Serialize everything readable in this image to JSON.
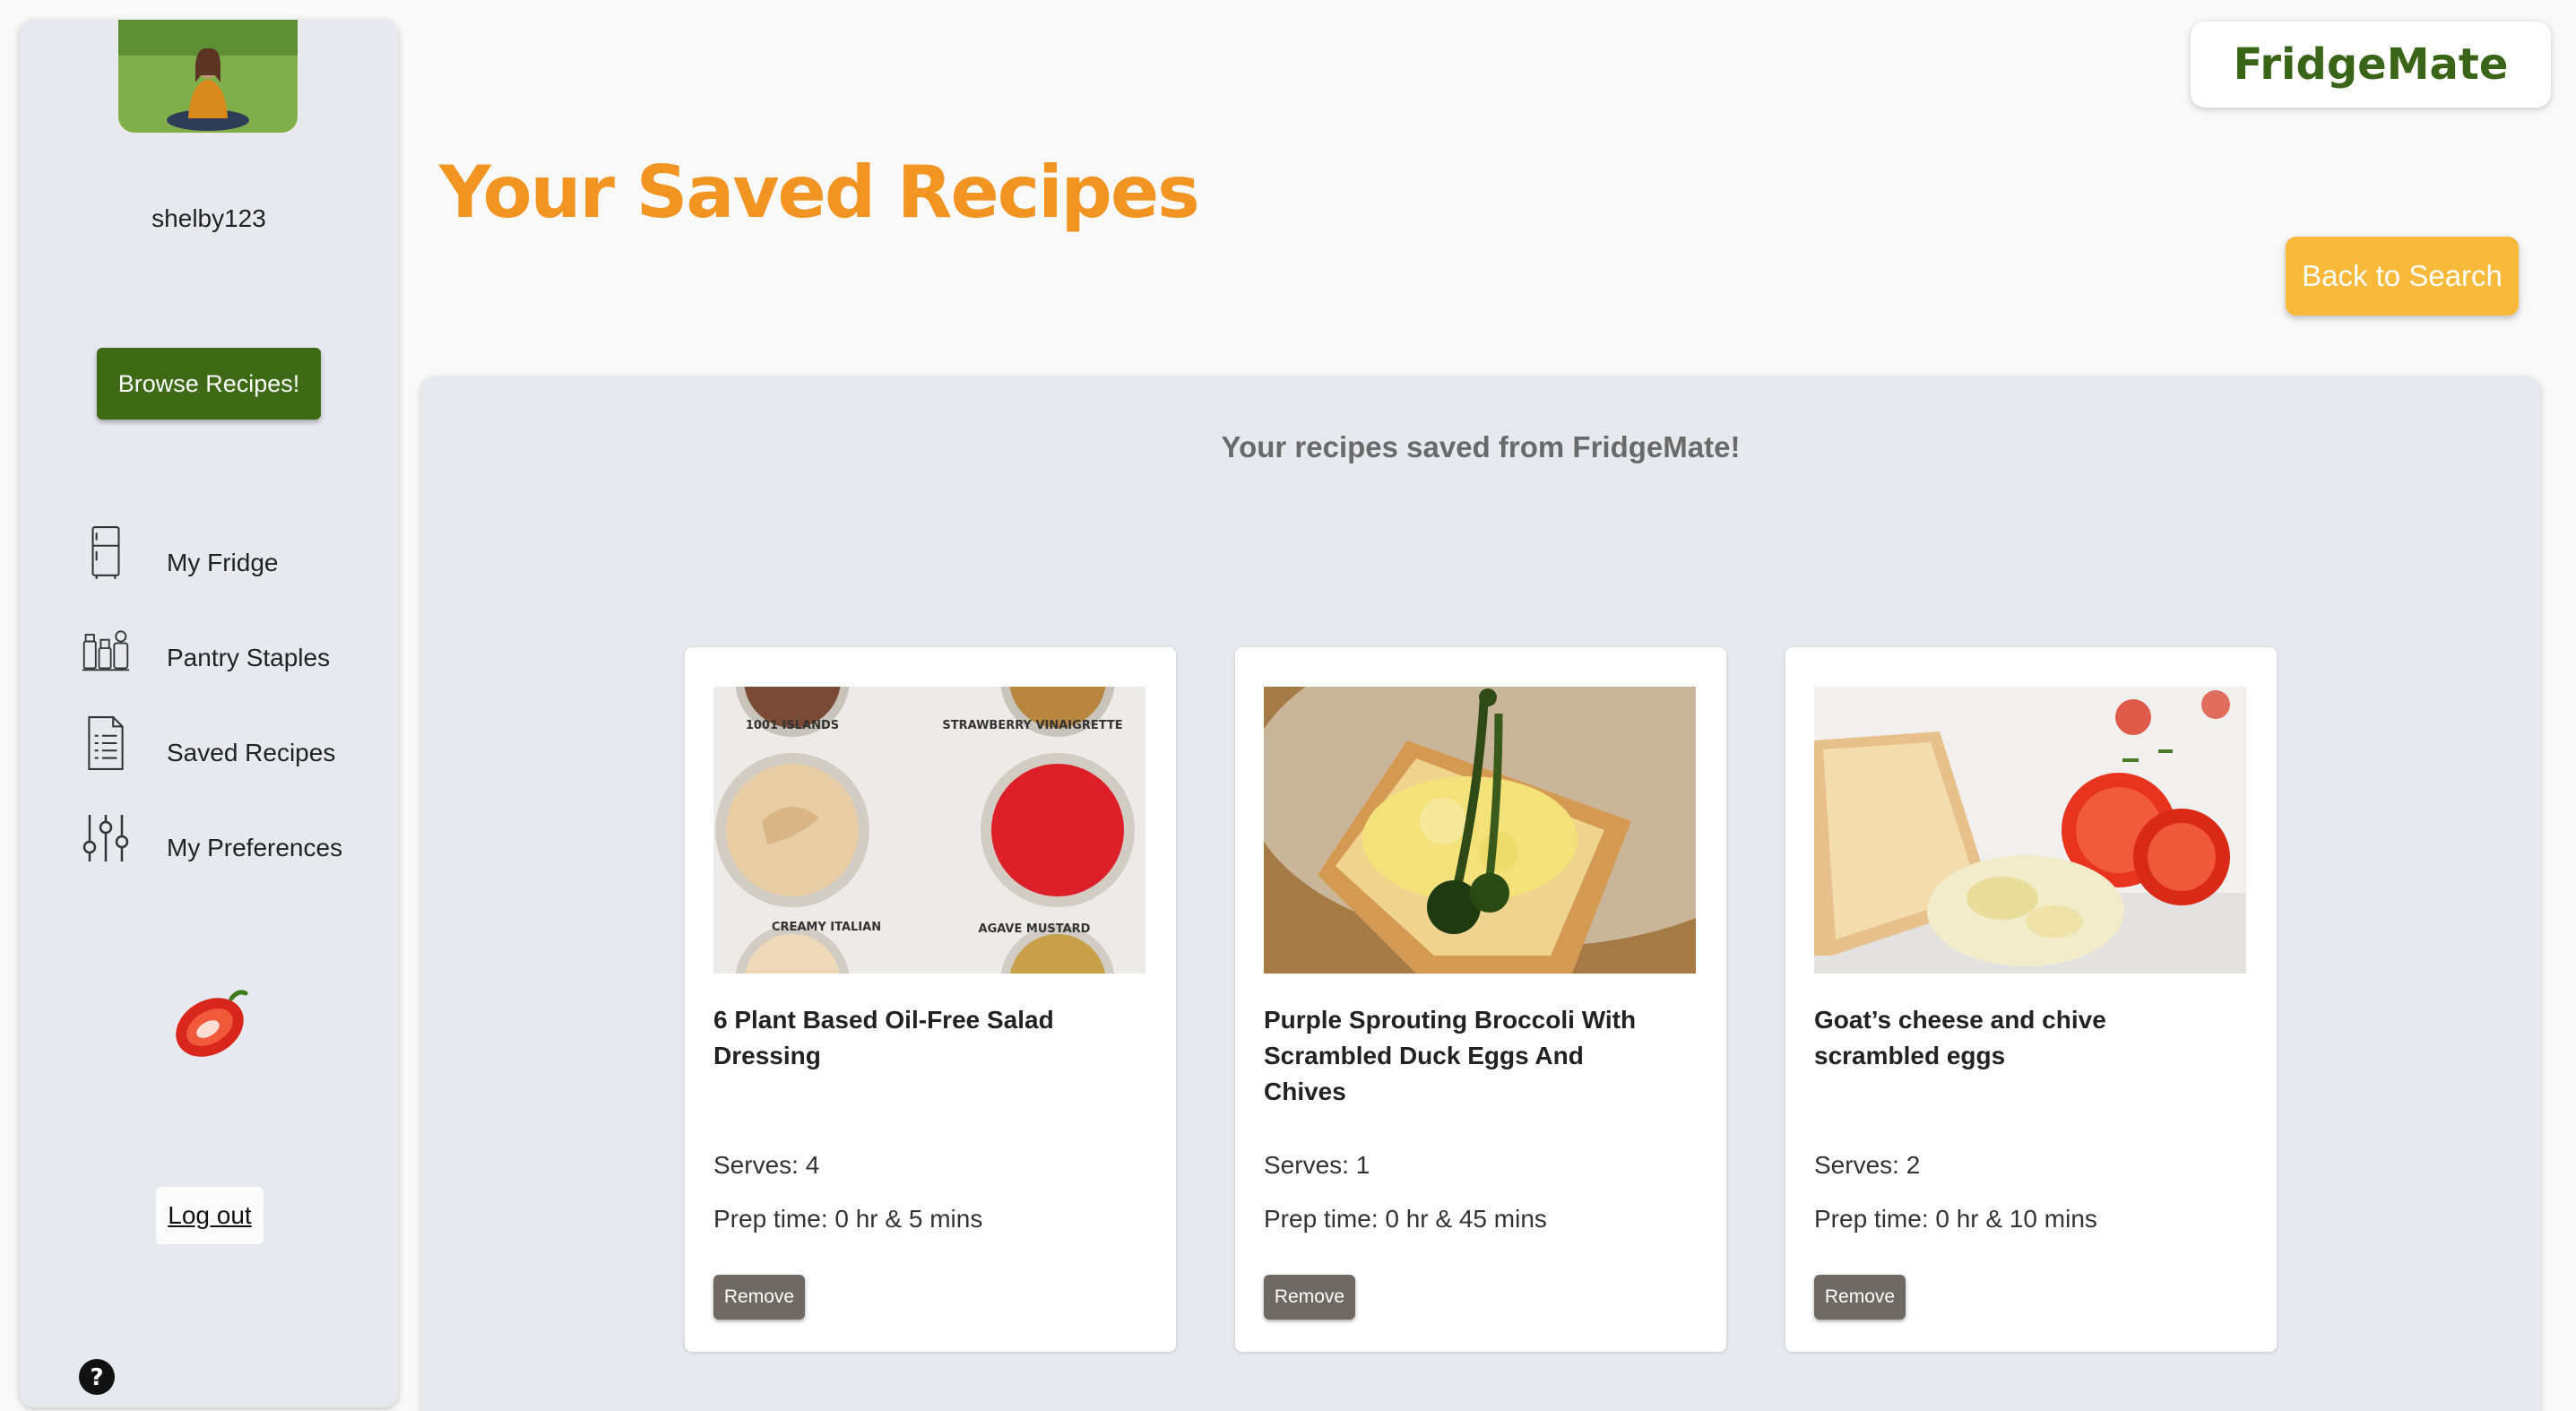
{
  "sidebar": {
    "username": "shelby123",
    "browse_button": "Browse Recipes!",
    "nav": [
      {
        "label": "My Fridge",
        "icon": "fridge-icon"
      },
      {
        "label": "Pantry Staples",
        "icon": "pantry-icon"
      },
      {
        "label": "Saved Recipes",
        "icon": "document-list-icon"
      },
      {
        "label": "My Preferences",
        "icon": "sliders-icon"
      }
    ],
    "logout": "Log out",
    "help_icon": "question-circle-icon"
  },
  "header": {
    "brand": "FridgeMate",
    "title": "Your Saved Recipes",
    "back_button": "Back to Search"
  },
  "main": {
    "subtitle": "Your recipes saved from FridgeMate!",
    "recipes": [
      {
        "title": "6 Plant Based Oil-Free Salad Dressing",
        "serves": "Serves: 4",
        "prep": "Prep time: 0 hr & 5 mins",
        "remove": "Remove",
        "image_labels": [
          "1001 ISLANDS",
          "STRAWBERRY VINAIGRETTE",
          "CREAMY ITALIAN",
          "AGAVE MUSTARD"
        ]
      },
      {
        "title": "Purple Sprouting Broccoli With Scrambled Duck Eggs And Chives",
        "serves": "Serves: 1",
        "prep": "Prep time: 0 hr & 45 mins",
        "remove": "Remove"
      },
      {
        "title": "Goat’s cheese and chive scrambled eggs",
        "serves": "Serves: 2",
        "prep": "Prep time: 0 hr & 10 mins",
        "remove": "Remove"
      }
    ]
  },
  "colors": {
    "brand_green": "#3e6a15",
    "title_orange": "#f29422",
    "back_yellow": "#f9b93b",
    "panel_gray": "#e8e9ee",
    "remove_gray": "#6e6963"
  }
}
